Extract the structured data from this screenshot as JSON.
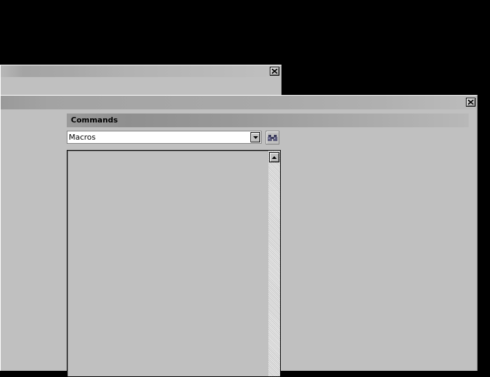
{
  "back_window": {
    "close_glyph": "close-icon"
  },
  "front_window": {
    "close_glyph": "close-icon",
    "commands_panel": {
      "title": "Commands",
      "category_select": {
        "value": "Macros"
      },
      "find_button_icon": "binoculars-icon",
      "list_items": []
    }
  },
  "colors": {
    "desktop": "#000000",
    "window_face": "#c0c0c0"
  }
}
